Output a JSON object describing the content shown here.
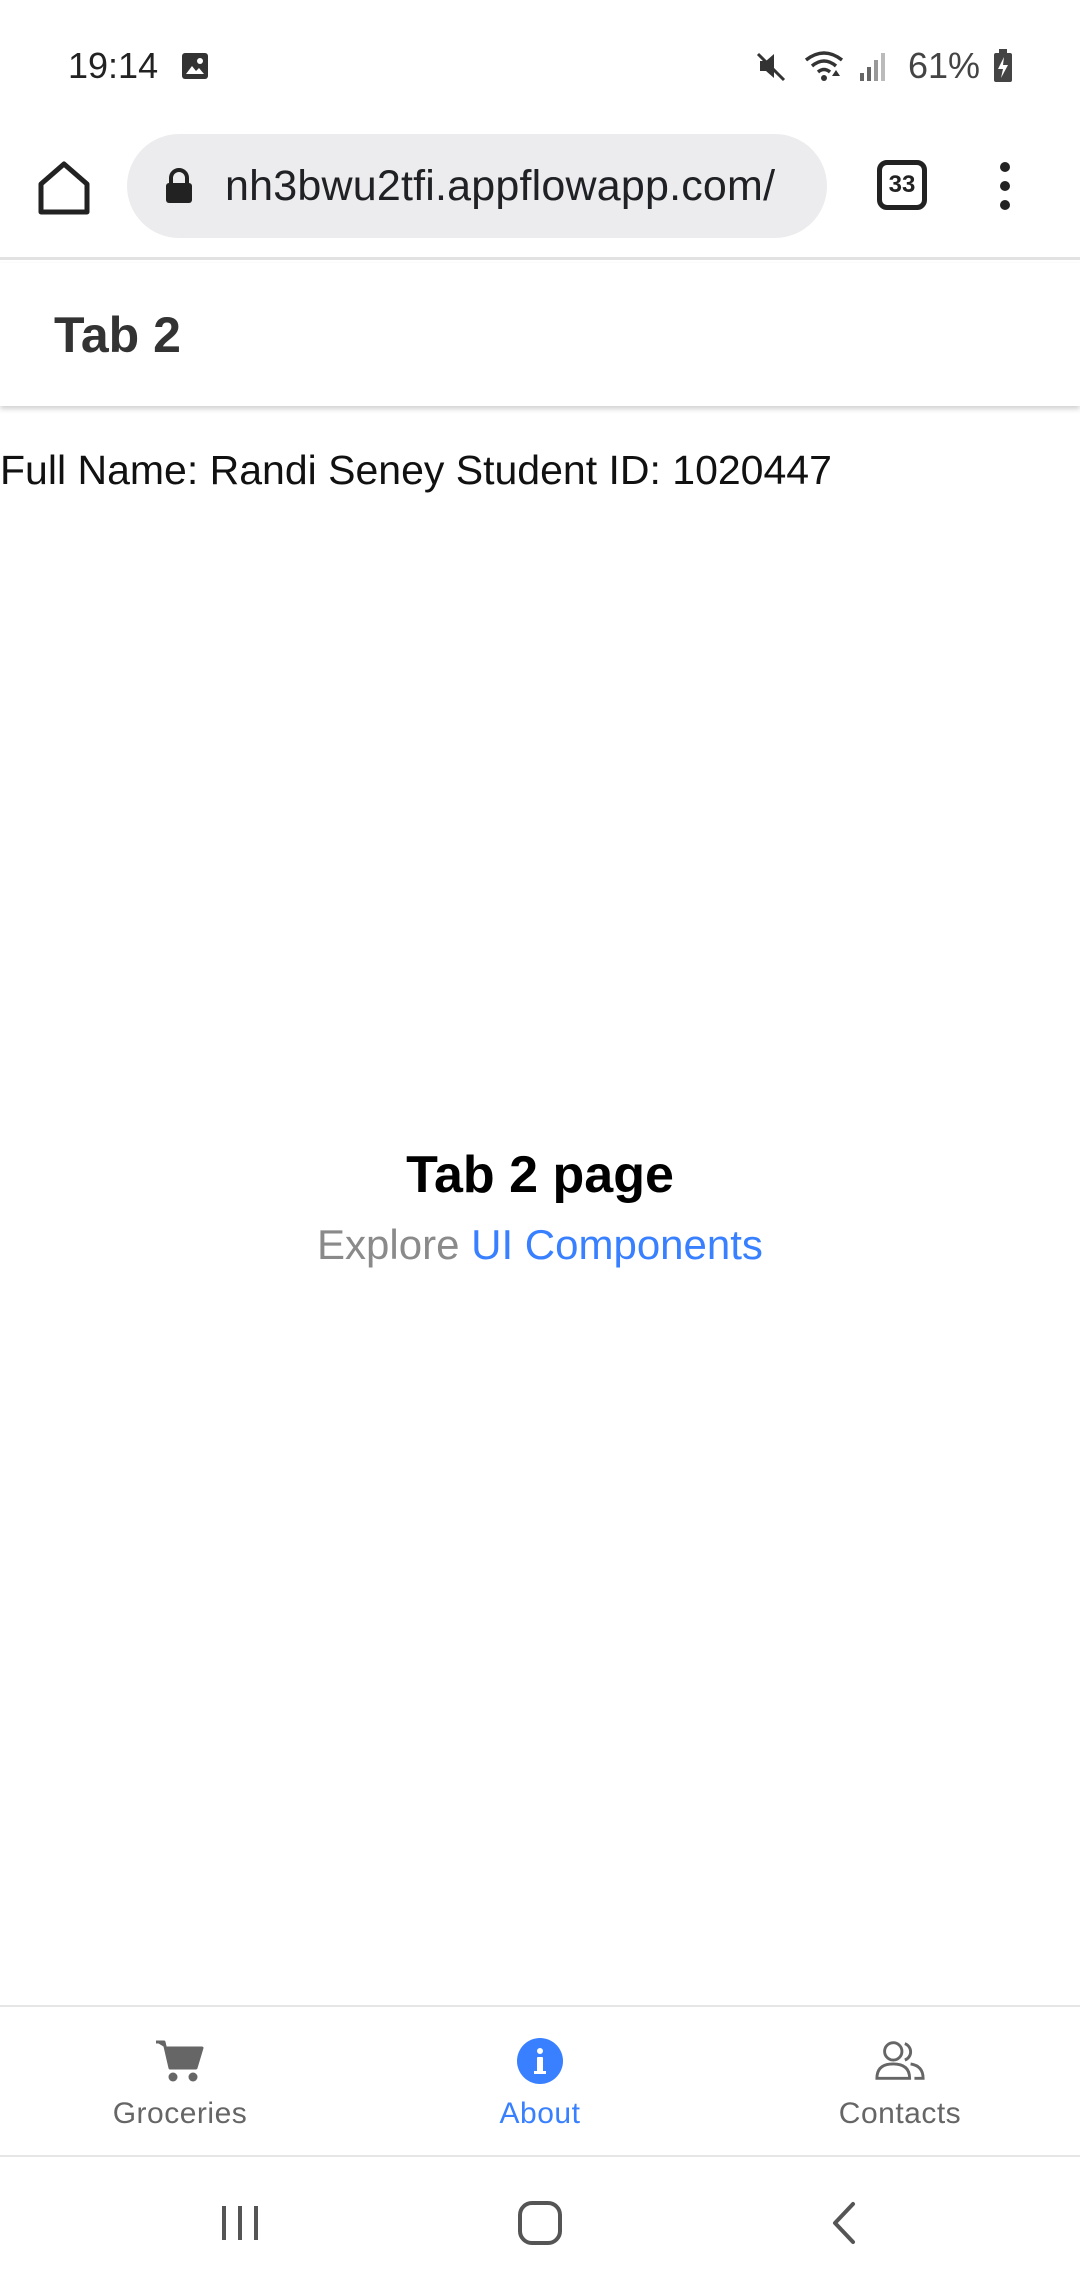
{
  "status_bar": {
    "time": "19:14",
    "battery": "61%",
    "icons": [
      "gallery-icon",
      "mute-icon",
      "wifi-icon",
      "signal-icon",
      "battery-charging-icon"
    ]
  },
  "browser": {
    "url": "nh3bwu2tfi.appflowapp.com/",
    "tab_count": "33",
    "icons": [
      "home-icon",
      "lock-icon",
      "tabs-icon",
      "more-menu-icon"
    ]
  },
  "header": {
    "title": "Tab 2"
  },
  "content": {
    "info_line": "Full Name: Randi Seney Student ID: 1020447",
    "page_title": "Tab 2 page",
    "explore_prefix": "Explore ",
    "explore_link": "UI Components"
  },
  "tab_bar": {
    "tabs": [
      {
        "label": "Groceries",
        "icon": "cart-icon",
        "active": false
      },
      {
        "label": "About",
        "icon": "info-icon",
        "active": true
      },
      {
        "label": "Contacts",
        "icon": "people-icon",
        "active": false
      }
    ],
    "active_color": "#3880ff",
    "inactive_color": "#666666"
  },
  "nav_bar": {
    "icons": [
      "recents-icon",
      "home-nav-icon",
      "back-icon"
    ]
  }
}
